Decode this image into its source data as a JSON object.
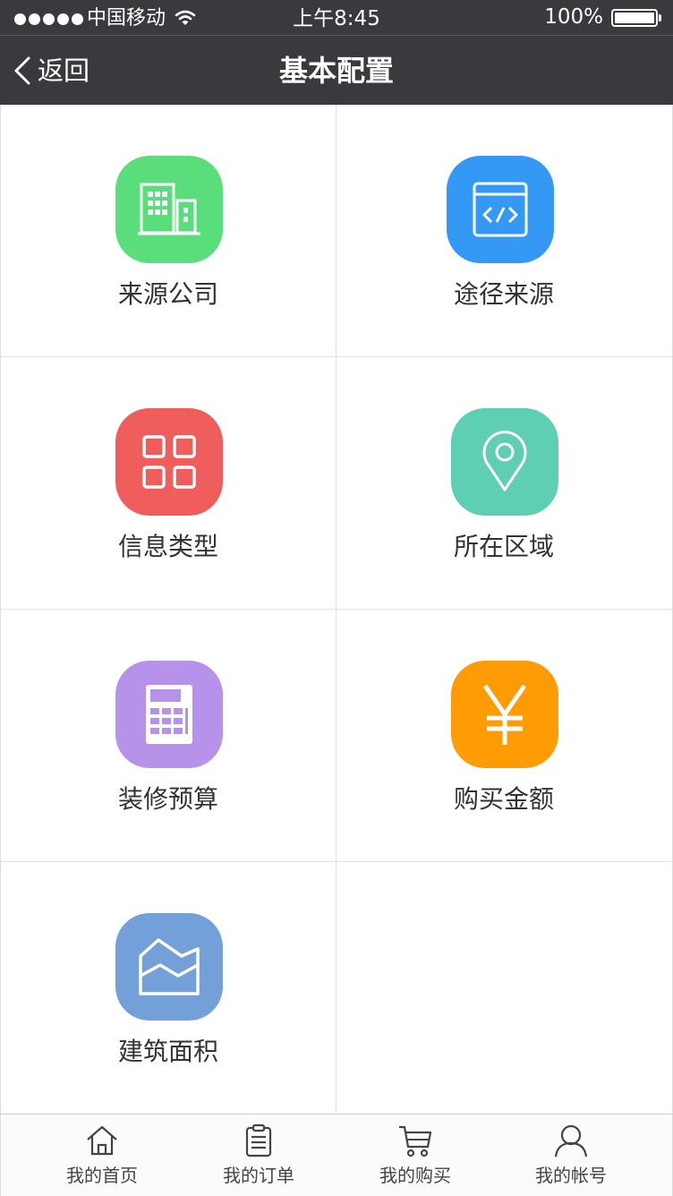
{
  "status_bar": {
    "carrier": "中国移动",
    "time": "上午8:45",
    "battery": "100%"
  },
  "nav": {
    "back_label": "返回",
    "title": "基本配置"
  },
  "grid": {
    "items": [
      {
        "label": "来源公司",
        "icon": "building-icon",
        "color": "#5ade7b"
      },
      {
        "label": "途径来源",
        "icon": "code-window-icon",
        "color": "#3399f5"
      },
      {
        "label": "信息类型",
        "icon": "grid-squares-icon",
        "color": "#ef5e5c"
      },
      {
        "label": "所在区域",
        "icon": "location-pin-icon",
        "color": "#5ecfb2"
      },
      {
        "label": "装修预算",
        "icon": "calculator-icon",
        "color": "#b692ea"
      },
      {
        "label": "购买金额",
        "icon": "yen-icon",
        "color": "#ff9c05"
      },
      {
        "label": "建筑面积",
        "icon": "area-chart-icon",
        "color": "#73a0d8"
      }
    ]
  },
  "tabbar": {
    "tabs": [
      {
        "label": "我的首页",
        "icon": "home-icon"
      },
      {
        "label": "我的订单",
        "icon": "clipboard-icon"
      },
      {
        "label": "我的购买",
        "icon": "cart-icon"
      },
      {
        "label": "我的帐号",
        "icon": "user-icon"
      }
    ]
  }
}
